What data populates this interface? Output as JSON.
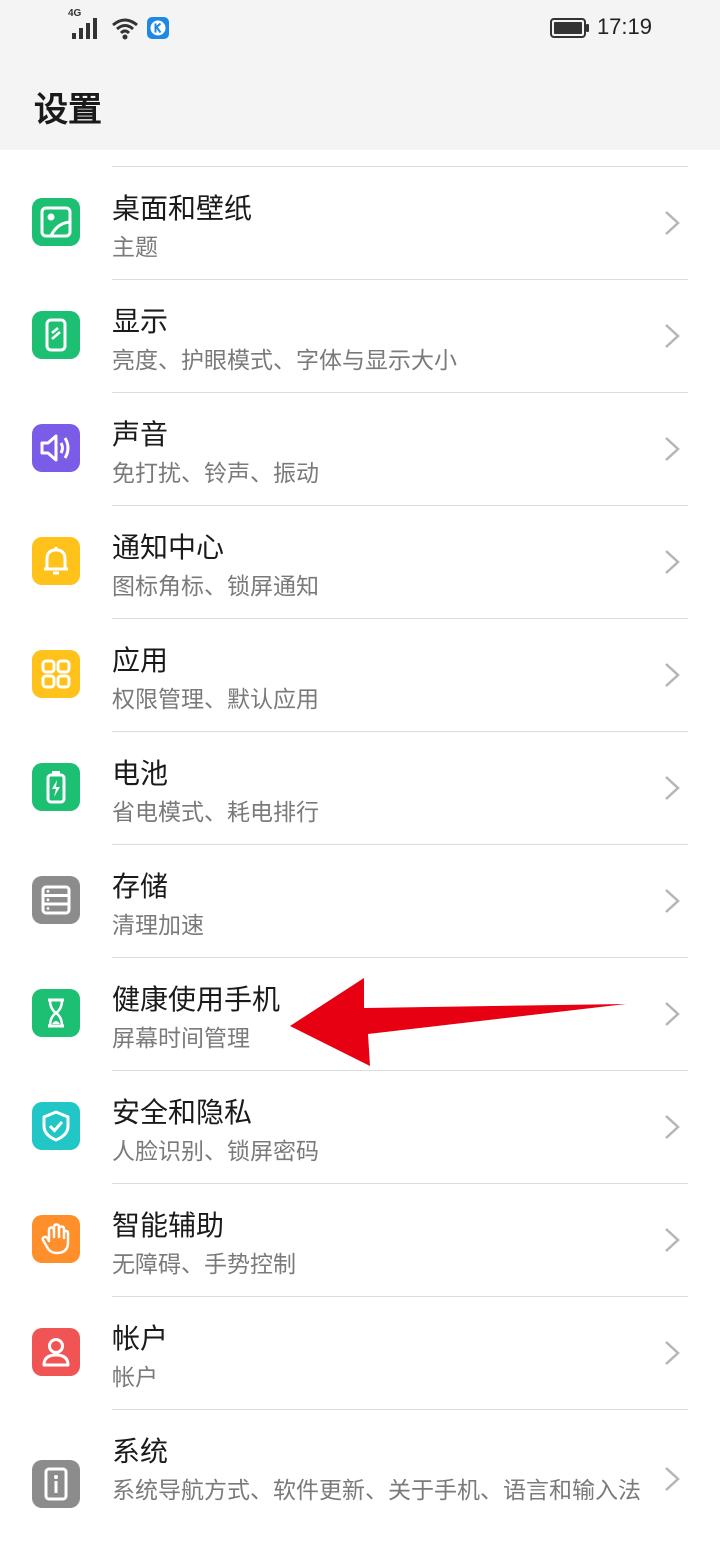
{
  "status_bar": {
    "network": "4G",
    "time": "17:19",
    "icons": [
      "signal-icon",
      "wifi-icon",
      "app-k-icon",
      "battery-icon"
    ]
  },
  "header": {
    "title": "设置"
  },
  "items": [
    {
      "title": "桌面和壁纸",
      "subtitle": "主题",
      "icon": "wallpaper-icon",
      "color": "#1dbf73"
    },
    {
      "title": "显示",
      "subtitle": "亮度、护眼模式、字体与显示大小",
      "icon": "display-icon",
      "color": "#1dbf73"
    },
    {
      "title": "声音",
      "subtitle": "免打扰、铃声、振动",
      "icon": "speaker-icon",
      "color": "#7b5ce6"
    },
    {
      "title": "通知中心",
      "subtitle": "图标角标、锁屏通知",
      "icon": "bell-icon",
      "color": "#ffc21a"
    },
    {
      "title": "应用",
      "subtitle": "权限管理、默认应用",
      "icon": "apps-grid-icon",
      "color": "#ffc21a"
    },
    {
      "title": "电池",
      "subtitle": "省电模式、耗电排行",
      "icon": "battery-charging-icon",
      "color": "#1dbf73"
    },
    {
      "title": "存储",
      "subtitle": "清理加速",
      "icon": "storage-icon",
      "color": "#8c8c8c"
    },
    {
      "title": "健康使用手机",
      "subtitle": "屏幕时间管理",
      "icon": "hourglass-icon",
      "color": "#1dbf73"
    },
    {
      "title": "安全和隐私",
      "subtitle": "人脸识别、锁屏密码",
      "icon": "shield-check-icon",
      "color": "#22c6c6"
    },
    {
      "title": "智能辅助",
      "subtitle": "无障碍、手势控制",
      "icon": "hand-icon",
      "color": "#ff8f2a"
    },
    {
      "title": "帐户",
      "subtitle": "帐户",
      "icon": "user-icon",
      "color": "#f05454"
    },
    {
      "title": "系统",
      "subtitle": "系统导航方式、软件更新、关于手机、语言和输入法",
      "icon": "info-icon",
      "color": "#8c8c8c"
    }
  ],
  "annotation": {
    "color": "#e60012"
  }
}
